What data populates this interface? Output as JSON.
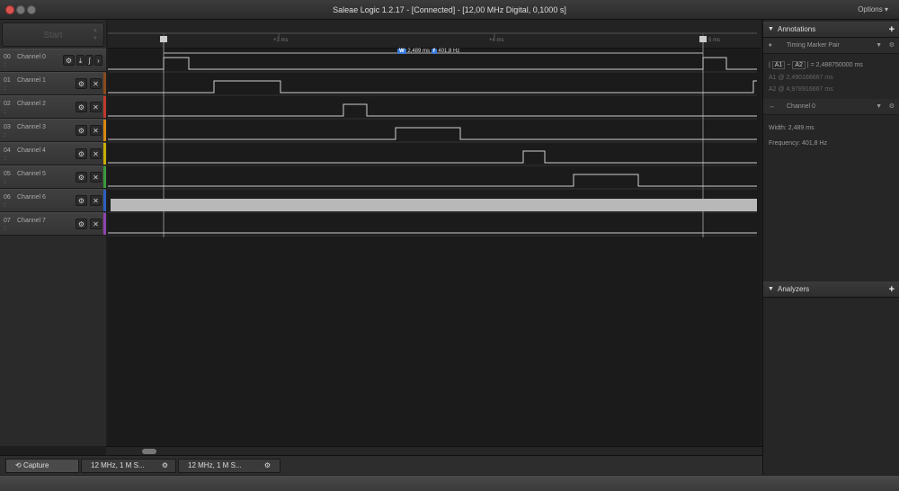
{
  "window": {
    "title": "Saleae Logic 1.2.17 - [Connected] - [12,00 MHz Digital, 0,1000 s]",
    "options_label": "Options ▾"
  },
  "capture": {
    "start_label": "Start"
  },
  "channels": [
    {
      "num": "00",
      "name": "Channel 0",
      "color": "#2a2a2a"
    },
    {
      "num": "01",
      "name": "Channel 1",
      "color": "#8a4a1a"
    },
    {
      "num": "02",
      "name": "Channel 2",
      "color": "#c0392b"
    },
    {
      "num": "03",
      "name": "Channel 3",
      "color": "#d68910"
    },
    {
      "num": "04",
      "name": "Channel 4",
      "color": "#c9b000"
    },
    {
      "num": "05",
      "name": "Channel 5",
      "color": "#3b9a3b"
    },
    {
      "num": "06",
      "name": "Channel 6",
      "color": "#2e5fbf"
    },
    {
      "num": "07",
      "name": "Channel 7",
      "color": "#8e44ad"
    }
  ],
  "timeline": {
    "ticks": [
      "+3 ms",
      "+4 ms",
      "5 ms"
    ],
    "measure_width": "2,489 ms",
    "measure_freq": "401,8 Hz",
    "width_badge": "W",
    "freq_badge": "f"
  },
  "tabs": [
    {
      "label": "Capture"
    },
    {
      "label": "12 MHz, 1 M S..."
    },
    {
      "label": "12 MHz, 1 M S..."
    }
  ],
  "annotations": {
    "header": "Annotations",
    "marker_pair": "Timing Marker Pair",
    "a1": "A1",
    "a2": "A2",
    "diff_value": "= 2,488750000 ms",
    "a1_line": "A1  @  2,490166667 ms",
    "a2_line": "A2  @  4,978916667 ms",
    "measure_channel": "Channel 0",
    "width_line": "Width: 2,489 ms",
    "freq_line": "Frequency: 401,8 Hz"
  },
  "analyzers": {
    "header": "Analyzers"
  },
  "colors": {
    "accent": "#3b7ad8",
    "trace": "#cfcfcf",
    "background": "#1b1b1b"
  }
}
